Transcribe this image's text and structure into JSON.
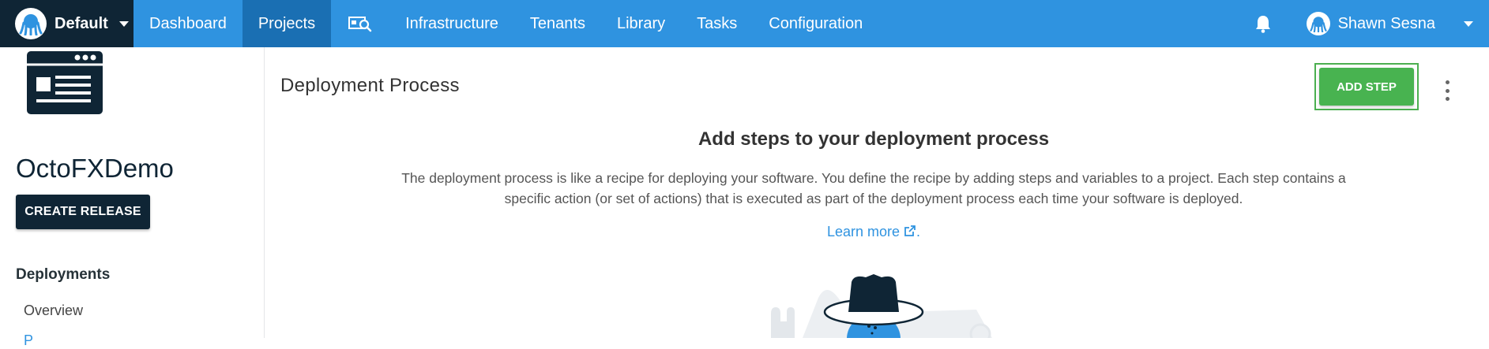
{
  "topbar": {
    "space_name": "Default",
    "nav": [
      {
        "label": "Dashboard"
      },
      {
        "label": "Projects"
      },
      {
        "label": "Infrastructure"
      },
      {
        "label": "Tenants"
      },
      {
        "label": "Library"
      },
      {
        "label": "Tasks"
      },
      {
        "label": "Configuration"
      }
    ],
    "active_nav": "Projects",
    "user_name": "Shawn Sesna",
    "icons": [
      "octopus-logo-icon",
      "chevron-down-icon",
      "machine-search-icon",
      "bell-icon",
      "user-avatar-icon"
    ]
  },
  "sidebar": {
    "project_name": "OctoFXDemo",
    "create_release_label": "CREATE RELEASE",
    "section_deployments": "Deployments",
    "link_overview": "Overview",
    "link_process_partial": "P"
  },
  "main": {
    "page_title": "Deployment Process",
    "add_step_label": "ADD STEP",
    "onboard_title": "Add steps to your deployment process",
    "onboard_text": "The deployment process is like a recipe for deploying your software. You define the recipe by adding steps and variables to a project. Each step contains a specific action (or set of actions) that is executed as part of the deployment process each time your software is deployed.",
    "learn_more": "Learn more",
    "learn_more_suffix": "."
  },
  "colors": {
    "topbar": "#2f93e0",
    "topbar_dark": "#0f2535",
    "active_nav": "#1a6fb3",
    "add_step": "#48b350",
    "link": "#2f93e0"
  }
}
